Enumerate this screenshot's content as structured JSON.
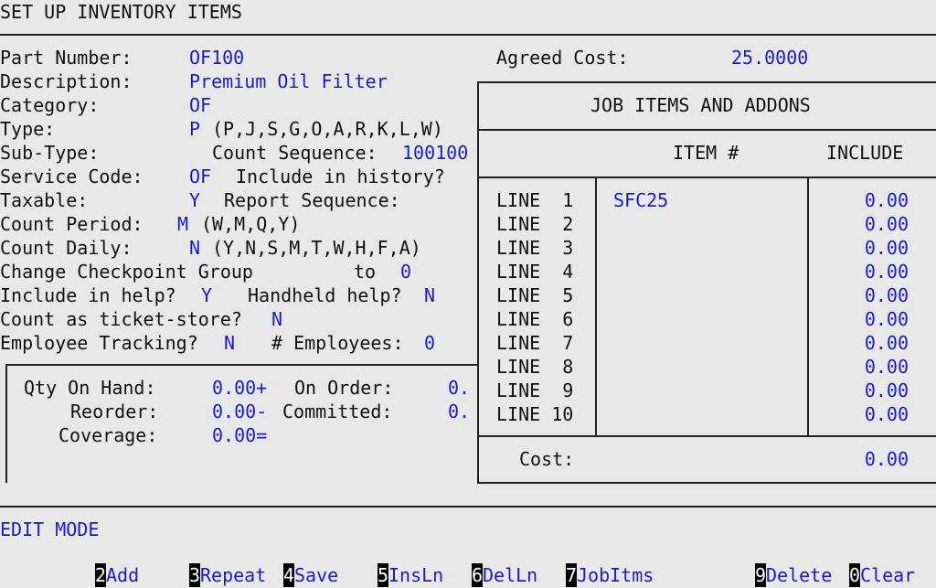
{
  "screen_title": "SET UP INVENTORY ITEMS",
  "fields": {
    "part_number": {
      "label": "Part Number:",
      "value": "OF100"
    },
    "description": {
      "label": "Description:",
      "value": "Premium Oil Filter"
    },
    "category": {
      "label": "Category:",
      "value": "OF"
    },
    "type": {
      "label": "Type:",
      "value": "P",
      "hint": "(P,J,S,G,O,A,R,K,L,W)"
    },
    "sub_type": {
      "label": "Sub-Type:"
    },
    "count_sequence": {
      "label": "Count Sequence:",
      "value": "100100"
    },
    "service_code": {
      "label": "Service Code:",
      "value": "OF"
    },
    "include_history": {
      "label": "Include in history?"
    },
    "taxable": {
      "label": "Taxable:",
      "value": "Y"
    },
    "report_sequence": {
      "label": "Report Sequence:"
    },
    "count_period": {
      "label": "Count Period:",
      "value": "M",
      "hint": "(W,M,Q,Y)"
    },
    "count_daily": {
      "label": "Count Daily:",
      "value": "N",
      "hint": "(Y,N,S,M,T,W,H,F,A)"
    },
    "checkpoint_group": {
      "label": "Change Checkpoint Group",
      "to_label": "to",
      "value": "0"
    },
    "include_help": {
      "label": "Include in help?",
      "value": "Y"
    },
    "handheld_help": {
      "label": "Handheld help?",
      "value": "N"
    },
    "ticket_store": {
      "label": "Count as ticket-store?",
      "value": "N"
    },
    "employee_tracking": {
      "label": "Employee Tracking?",
      "value": "N"
    },
    "employees": {
      "label": "# Employees:",
      "value": "0"
    },
    "agreed_cost": {
      "label": "Agreed Cost:",
      "value": "25.0000"
    }
  },
  "quantities": {
    "qty_on_hand": {
      "label": "Qty On Hand:",
      "value": "0.00+"
    },
    "on_order": {
      "label": "On Order:",
      "value": "0."
    },
    "reorder": {
      "label": "Reorder:",
      "value": "0.00-"
    },
    "committed": {
      "label": "Committed:",
      "value": "0."
    },
    "coverage": {
      "label": "Coverage:",
      "value": "0.00="
    }
  },
  "job_items": {
    "title": "JOB ITEMS AND ADDONS",
    "col_item": "ITEM #",
    "col_include": "INCLUDE",
    "rows": [
      {
        "line": "LINE  1",
        "item": "SFC25",
        "include": "0.00"
      },
      {
        "line": "LINE  2",
        "item": "",
        "include": "0.00"
      },
      {
        "line": "LINE  3",
        "item": "",
        "include": "0.00"
      },
      {
        "line": "LINE  4",
        "item": "",
        "include": "0.00"
      },
      {
        "line": "LINE  5",
        "item": "",
        "include": "0.00"
      },
      {
        "line": "LINE  6",
        "item": "",
        "include": "0.00"
      },
      {
        "line": "LINE  7",
        "item": "",
        "include": "0.00"
      },
      {
        "line": "LINE  8",
        "item": "",
        "include": "0.00"
      },
      {
        "line": "LINE  9",
        "item": "",
        "include": "0.00"
      },
      {
        "line": "LINE 10",
        "item": "",
        "include": "0.00"
      }
    ],
    "cost_label": "Cost:",
    "cost_value": "0.00"
  },
  "mode": "EDIT MODE",
  "function_keys": [
    {
      "key": "2",
      "label": "Add"
    },
    {
      "key": "3",
      "label": "Repeat"
    },
    {
      "key": "4",
      "label": "Save"
    },
    {
      "key": "5",
      "label": "InsLn"
    },
    {
      "key": "6",
      "label": "DelLn"
    },
    {
      "key": "7",
      "label": "JobItms"
    },
    {
      "key": "9",
      "label": "Delete"
    },
    {
      "key": "0",
      "label": "Clear"
    }
  ]
}
